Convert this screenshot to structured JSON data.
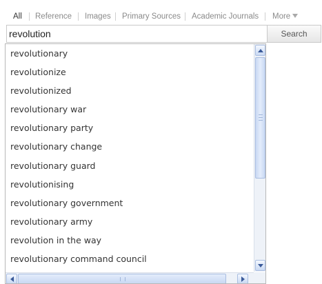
{
  "tabs": [
    {
      "label": "All",
      "active": true
    },
    {
      "label": "Reference",
      "active": false
    },
    {
      "label": "Images",
      "active": false
    },
    {
      "label": "Primary Sources",
      "active": false
    },
    {
      "label": "Academic Journals",
      "active": false
    },
    {
      "label": "More",
      "active": false
    }
  ],
  "search": {
    "query": "revolution",
    "button_label": "Search"
  },
  "suggestions": [
    "revolutionary",
    "revolutionize",
    "revolutionized",
    "revolutionary war",
    "revolutionary party",
    "revolutionary change",
    "revolutionary guard",
    "revolutionising",
    "revolutionary government",
    "revolutionary army",
    "revolution in the way",
    "revolutionary command council"
  ],
  "icons": {
    "more": "chevron-down-icon",
    "scroll_up": "scroll-up-arrow-icon",
    "scroll_down": "scroll-down-arrow-icon",
    "scroll_left": "scroll-left-arrow-icon",
    "scroll_right": "scroll-right-arrow-icon"
  },
  "colors": {
    "active_tab": "#333333",
    "inactive_tab": "#8a8a8a",
    "scrollbar_accent": "#c9d9f3"
  }
}
